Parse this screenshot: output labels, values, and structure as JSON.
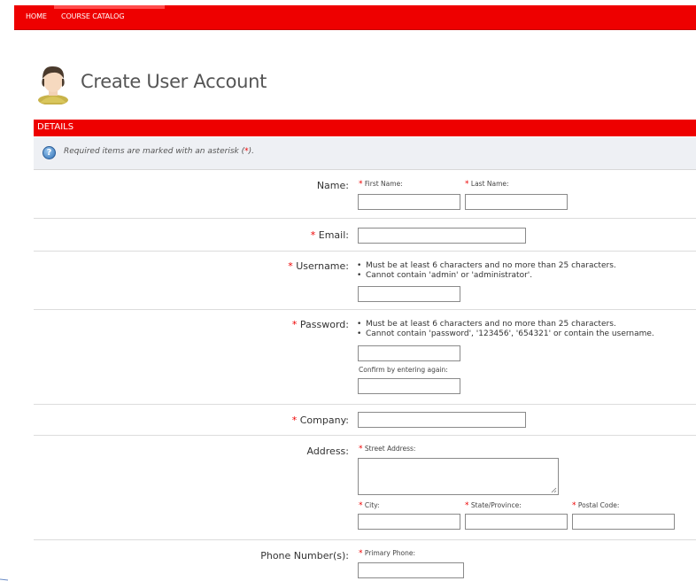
{
  "nav": {
    "home": "HOME",
    "catalog": "COURSE CATALOG"
  },
  "page": {
    "title": "Create User Account",
    "icon": "user-avatar-icon"
  },
  "details": {
    "title": "DETAILS"
  },
  "info": {
    "text_before": "Required items are marked with an asterisk (",
    "asterisk": "*",
    "text_after": ")."
  },
  "form": {
    "name": {
      "label": "Name:",
      "first": "First Name:",
      "last": "Last Name:"
    },
    "email": {
      "label": "Email:"
    },
    "username": {
      "label": "Username:",
      "rules": [
        "Must be at least 6 characters and no more than 25 characters.",
        "Cannot contain 'admin' or 'administrator'."
      ]
    },
    "password": {
      "label": "Password:",
      "rules": [
        "Must be at least 6 characters and no more than 25 characters.",
        "Cannot contain 'password', '123456', '654321' or contain the username."
      ],
      "confirm": "Confirm by entering again:"
    },
    "company": {
      "label": "Company:"
    },
    "address": {
      "label": "Address:",
      "street": "Street Address:",
      "city": "City:",
      "state": "State/Province:",
      "postal": "Postal Code:"
    },
    "phone": {
      "label": "Phone Number(s):",
      "primary": "Primary Phone:"
    }
  },
  "asterisk": "*",
  "colors": {
    "accent": "#ee0000"
  }
}
